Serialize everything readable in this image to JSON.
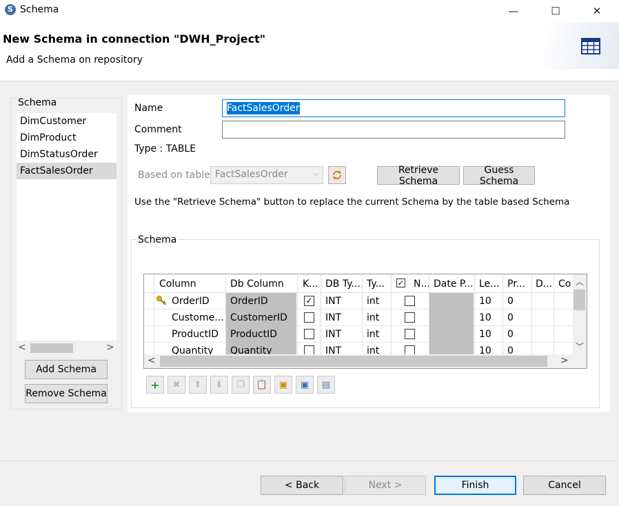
{
  "window": {
    "title": "Schema",
    "app_icon": "talend-icon",
    "minimize": "—",
    "maximize": "☐",
    "close": "✕"
  },
  "header": {
    "title": "New Schema in connection \"DWH_Project\"",
    "subtitle": "Add a Schema on repository",
    "icon": "table-icon"
  },
  "left_panel": {
    "title": "Schema",
    "items": [
      {
        "label": "DimCustomer",
        "selected": false
      },
      {
        "label": "DimProduct",
        "selected": false
      },
      {
        "label": "DimStatusOrder",
        "selected": false
      },
      {
        "label": "FactSalesOrder",
        "selected": true
      }
    ],
    "add_button": "Add Schema",
    "remove_button": "Remove Schema"
  },
  "form": {
    "name_label": "Name",
    "name_value": "FactSalesOrder",
    "comment_label": "Comment",
    "comment_value": "",
    "type_label": "Type : TABLE",
    "based_on_label": "Based on table",
    "based_on_value": "FactSalesOrder",
    "retrieve_button": "Retrieve Schema",
    "guess_button": "Guess Schema",
    "hint": "Use the \"Retrieve Schema\" button to replace the current Schema by the table based Schema"
  },
  "schema_group": {
    "title": "Schema",
    "columns": [
      "Column",
      "Db Column",
      "K...",
      "DB Ty...",
      "Ty...",
      "N...",
      "Date P...",
      "Le...",
      "Pr...",
      "D...",
      "Co"
    ],
    "rows": [
      {
        "column": "OrderID",
        "db_column": "OrderID",
        "key": true,
        "db_type": "INT",
        "type": "int",
        "nullable": false,
        "length": "10",
        "precision": "0"
      },
      {
        "column": "Custome...",
        "db_column": "CustomerID",
        "key": false,
        "db_type": "INT",
        "type": "int",
        "nullable": false,
        "length": "10",
        "precision": "0"
      },
      {
        "column": "ProductID",
        "db_column": "ProductID",
        "key": false,
        "db_type": "INT",
        "type": "int",
        "nullable": false,
        "length": "10",
        "precision": "0"
      },
      {
        "column": "Quantity",
        "db_column": "Quantity",
        "key": false,
        "db_type": "INT",
        "type": "int",
        "nullable": false,
        "length": "10",
        "precision": "0"
      }
    ],
    "toolbar": [
      "add-icon",
      "remove-icon",
      "move-up-icon",
      "move-down-icon",
      "copy-icon",
      "paste-icon",
      "import-icon",
      "export-icon",
      "reset-icon"
    ]
  },
  "footer": {
    "back": "< Back",
    "next": "Next >",
    "finish": "Finish",
    "cancel": "Cancel"
  },
  "colors": {
    "selection": "#0078d7",
    "focus": "#0078d7",
    "dialog_bg": "#f0f0f0",
    "list_selected": "#d9d9d9",
    "readonly_cell": "#c0c0c0"
  }
}
